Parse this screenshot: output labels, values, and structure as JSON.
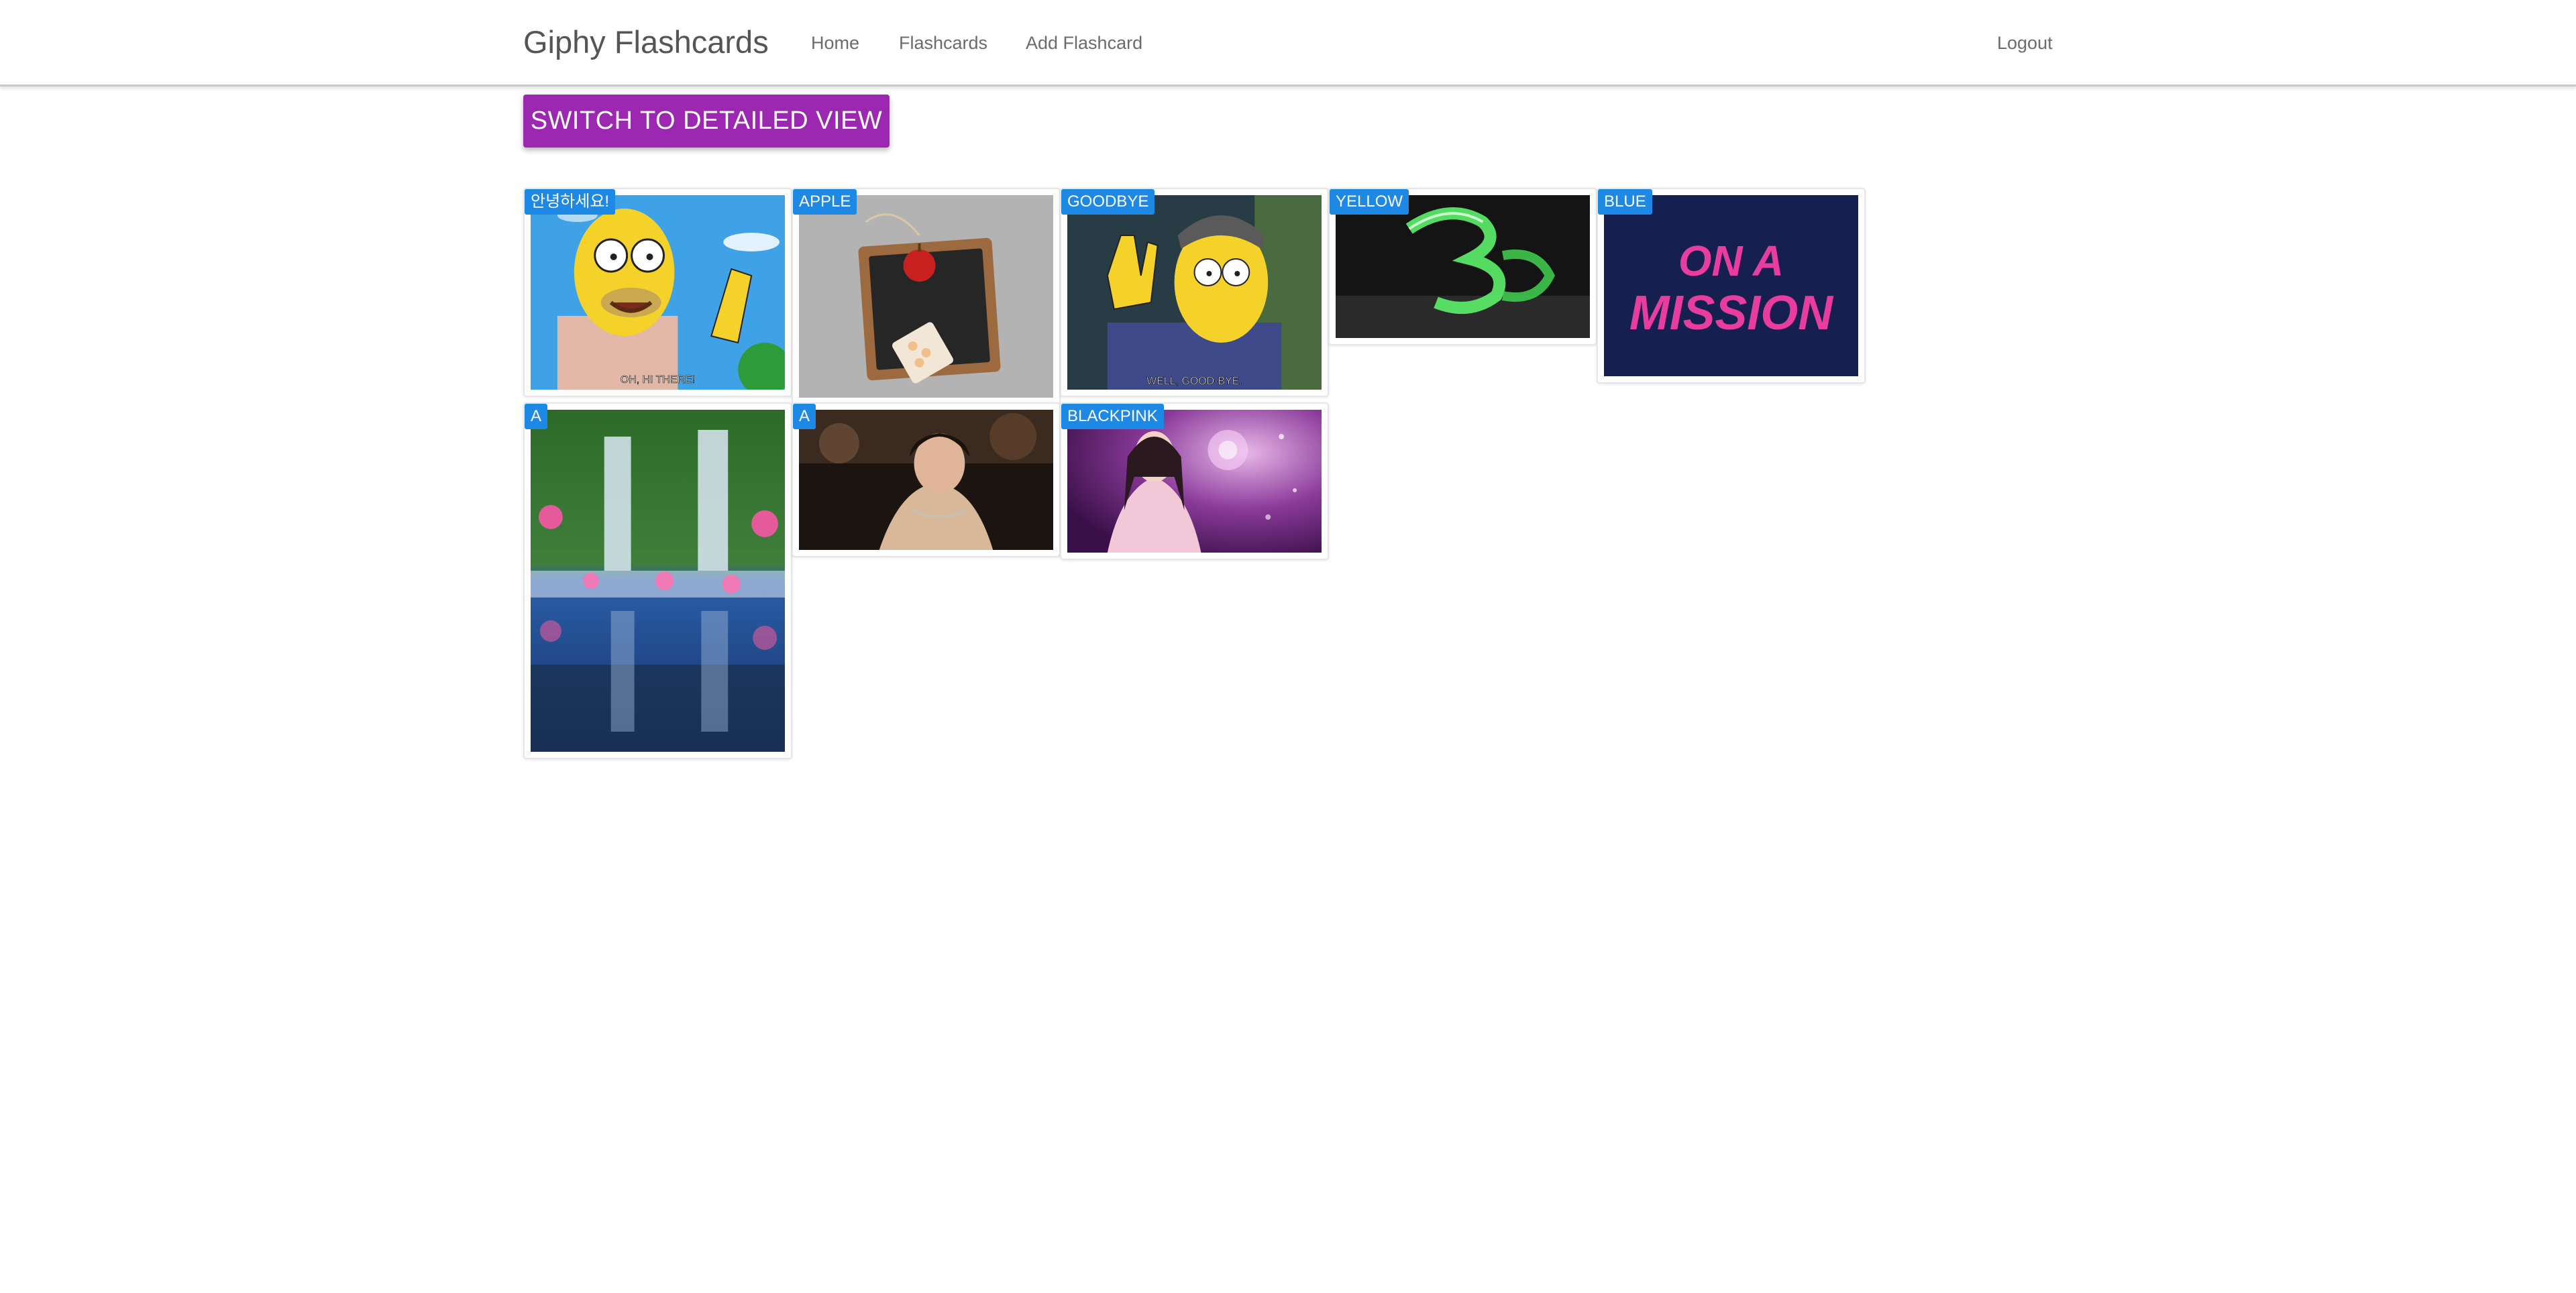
{
  "navbar": {
    "brand": "Giphy Flashcards",
    "links": {
      "home": "Home",
      "flashcards": "Flashcards",
      "add_flashcard": "Add Flashcard",
      "logout": "Logout"
    }
  },
  "toolbar": {
    "switch_view_label": "SWITCH TO DETAILED VIEW"
  },
  "cards": [
    {
      "word": "안녕하세요!",
      "gif_caption": "OH, HI THERE!"
    },
    {
      "word": "APPLE"
    },
    {
      "word": "GOODBYE",
      "gif_caption": "WELL, GOOD-BYE."
    },
    {
      "word": "YELLOW"
    },
    {
      "word": "BLUE",
      "gif_text_line1": "ON A",
      "gif_text_line2": "MISSION"
    },
    {
      "word": "A"
    },
    {
      "word": "A"
    },
    {
      "word": "BLACKPINK"
    }
  ],
  "colors": {
    "accent_purple": "#9c27b0",
    "badge_blue": "#1e88e5"
  }
}
